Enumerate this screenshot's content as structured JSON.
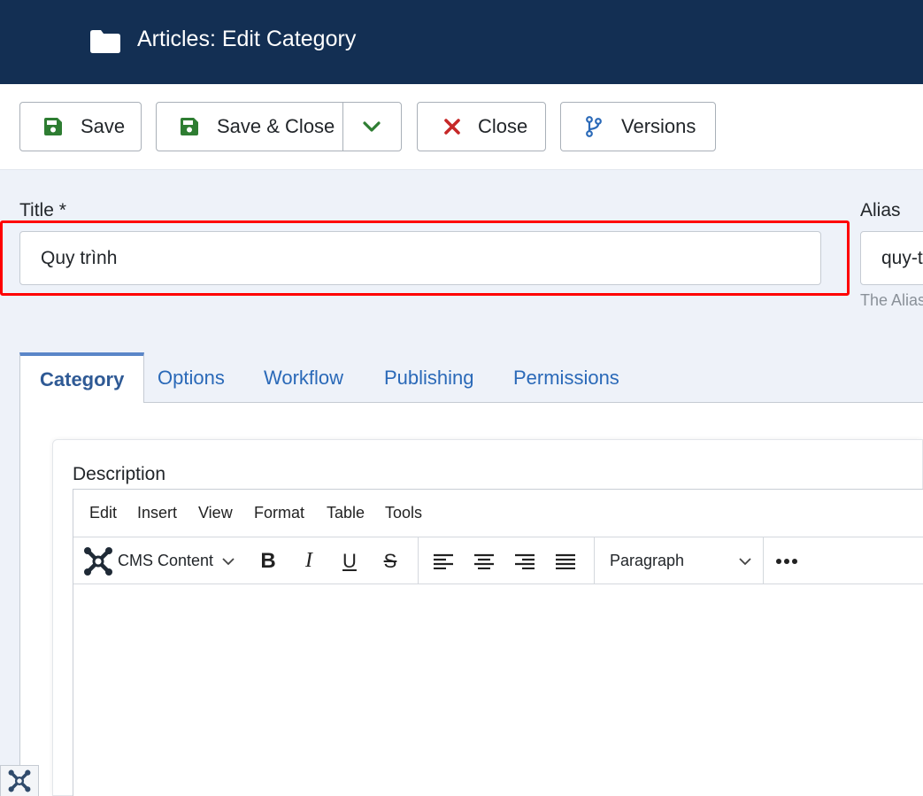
{
  "header": {
    "title": "Articles: Edit Category",
    "icon": "folder-icon"
  },
  "toolbar": {
    "save_label": "Save",
    "save_close_label": "Save & Close",
    "close_label": "Close",
    "versions_label": "Versions"
  },
  "form": {
    "title_label": "Title *",
    "title_value": "Quy trình",
    "alias_label": "Alias",
    "alias_value": "quy-t",
    "alias_hint": "The Alias"
  },
  "tabs": [
    {
      "label": "Category",
      "active": true
    },
    {
      "label": "Options",
      "active": false
    },
    {
      "label": "Workflow",
      "active": false
    },
    {
      "label": "Publishing",
      "active": false
    },
    {
      "label": "Permissions",
      "active": false
    }
  ],
  "editor": {
    "description_label": "Description",
    "menu": [
      "Edit",
      "Insert",
      "View",
      "Format",
      "Table",
      "Tools"
    ],
    "cms_content_label": "CMS Content",
    "block_format": "Paragraph"
  },
  "colors": {
    "header_bg": "#132f53",
    "save_green": "#2e7d32",
    "close_red": "#c62828",
    "versions_blue": "#2a69b8",
    "highlight": "#ff0000",
    "tab_link": "#2a69b8"
  }
}
